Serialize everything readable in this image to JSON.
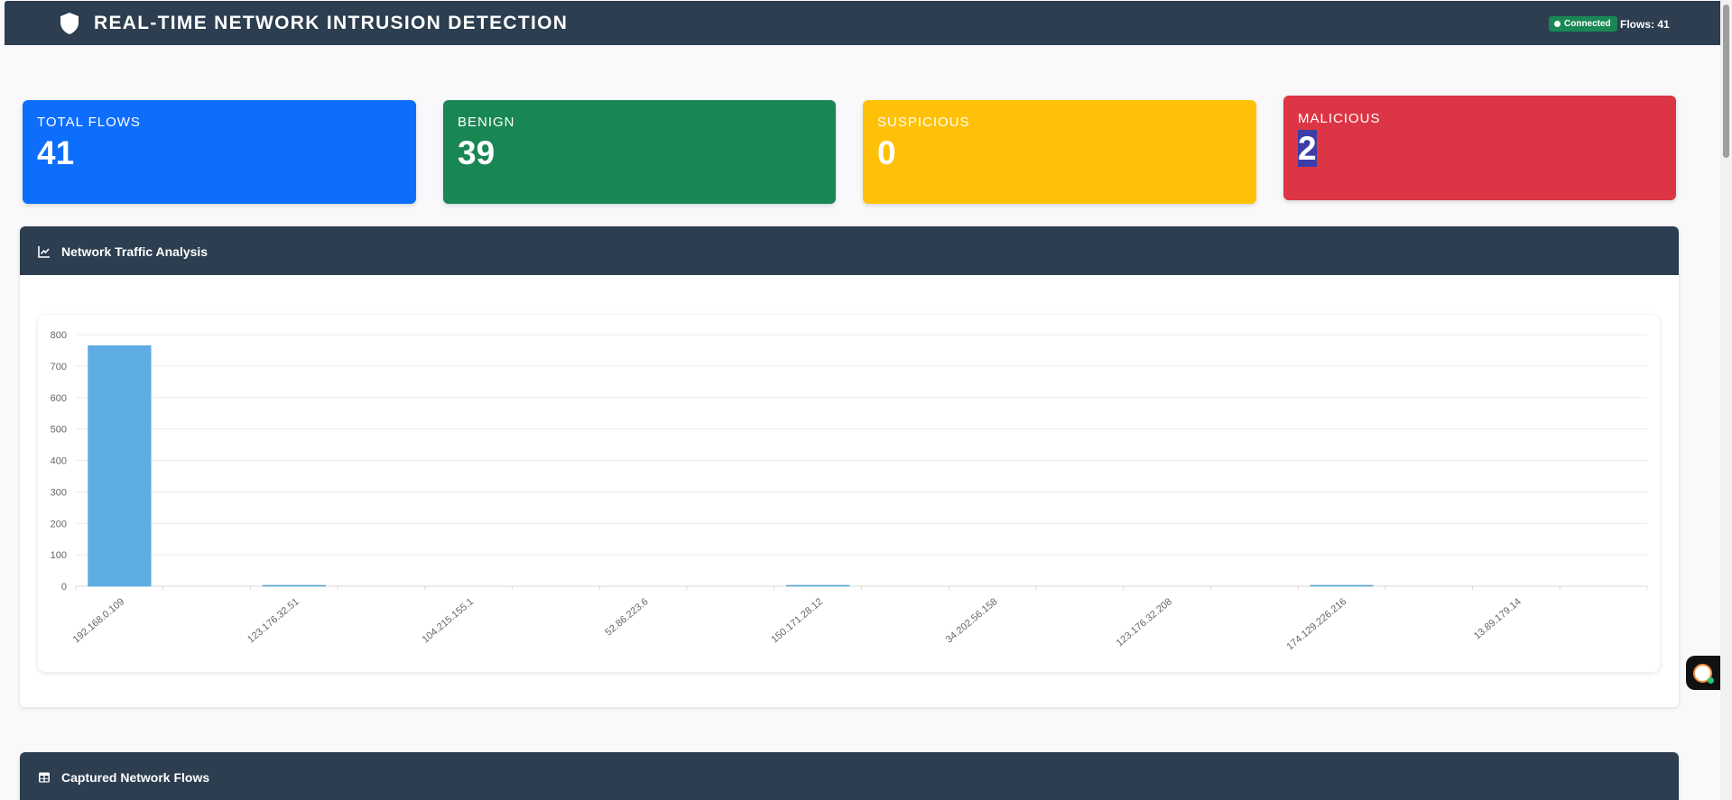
{
  "header": {
    "title": "REAL-TIME NETWORK INTRUSION DETECTION",
    "status": "Connected",
    "flows_text": "Flows: 41"
  },
  "stats": [
    {
      "label": "TOTAL FLOWS",
      "value": "41"
    },
    {
      "label": "BENIGN",
      "value": "39"
    },
    {
      "label": "SUSPICIOUS",
      "value": "0"
    },
    {
      "label": "MALICIOUS",
      "value": "2"
    }
  ],
  "traffic_panel": {
    "title": "Network Traffic Analysis"
  },
  "flows_panel": {
    "title": "Captured Network Flows"
  },
  "colors": {
    "header_bg": "#2c3e50",
    "total": "#0d6efd",
    "benign": "#198754",
    "suspicious": "#ffc107",
    "malicious": "#dc3545",
    "bar": "#5dade2"
  },
  "chart_data": {
    "type": "bar",
    "categories": [
      "192.168.0.109",
      "",
      "123.176.32.51",
      "",
      "104.215.155.1",
      "",
      "52.86.223.6",
      "",
      "150.171.28.12",
      "",
      "34.202.56.158",
      "",
      "123.176.32.208",
      "",
      "174.129.226.216",
      "",
      "13.89.179.14",
      ""
    ],
    "values": [
      765,
      0,
      3,
      0,
      0,
      0,
      0,
      0,
      3,
      0,
      0,
      0,
      0,
      0,
      3,
      0,
      0,
      0
    ],
    "ylim": [
      0,
      800
    ],
    "yticks": [
      "800",
      "700",
      "600",
      "500",
      "400",
      "300",
      "200",
      "100",
      "0"
    ],
    "grid": true
  }
}
